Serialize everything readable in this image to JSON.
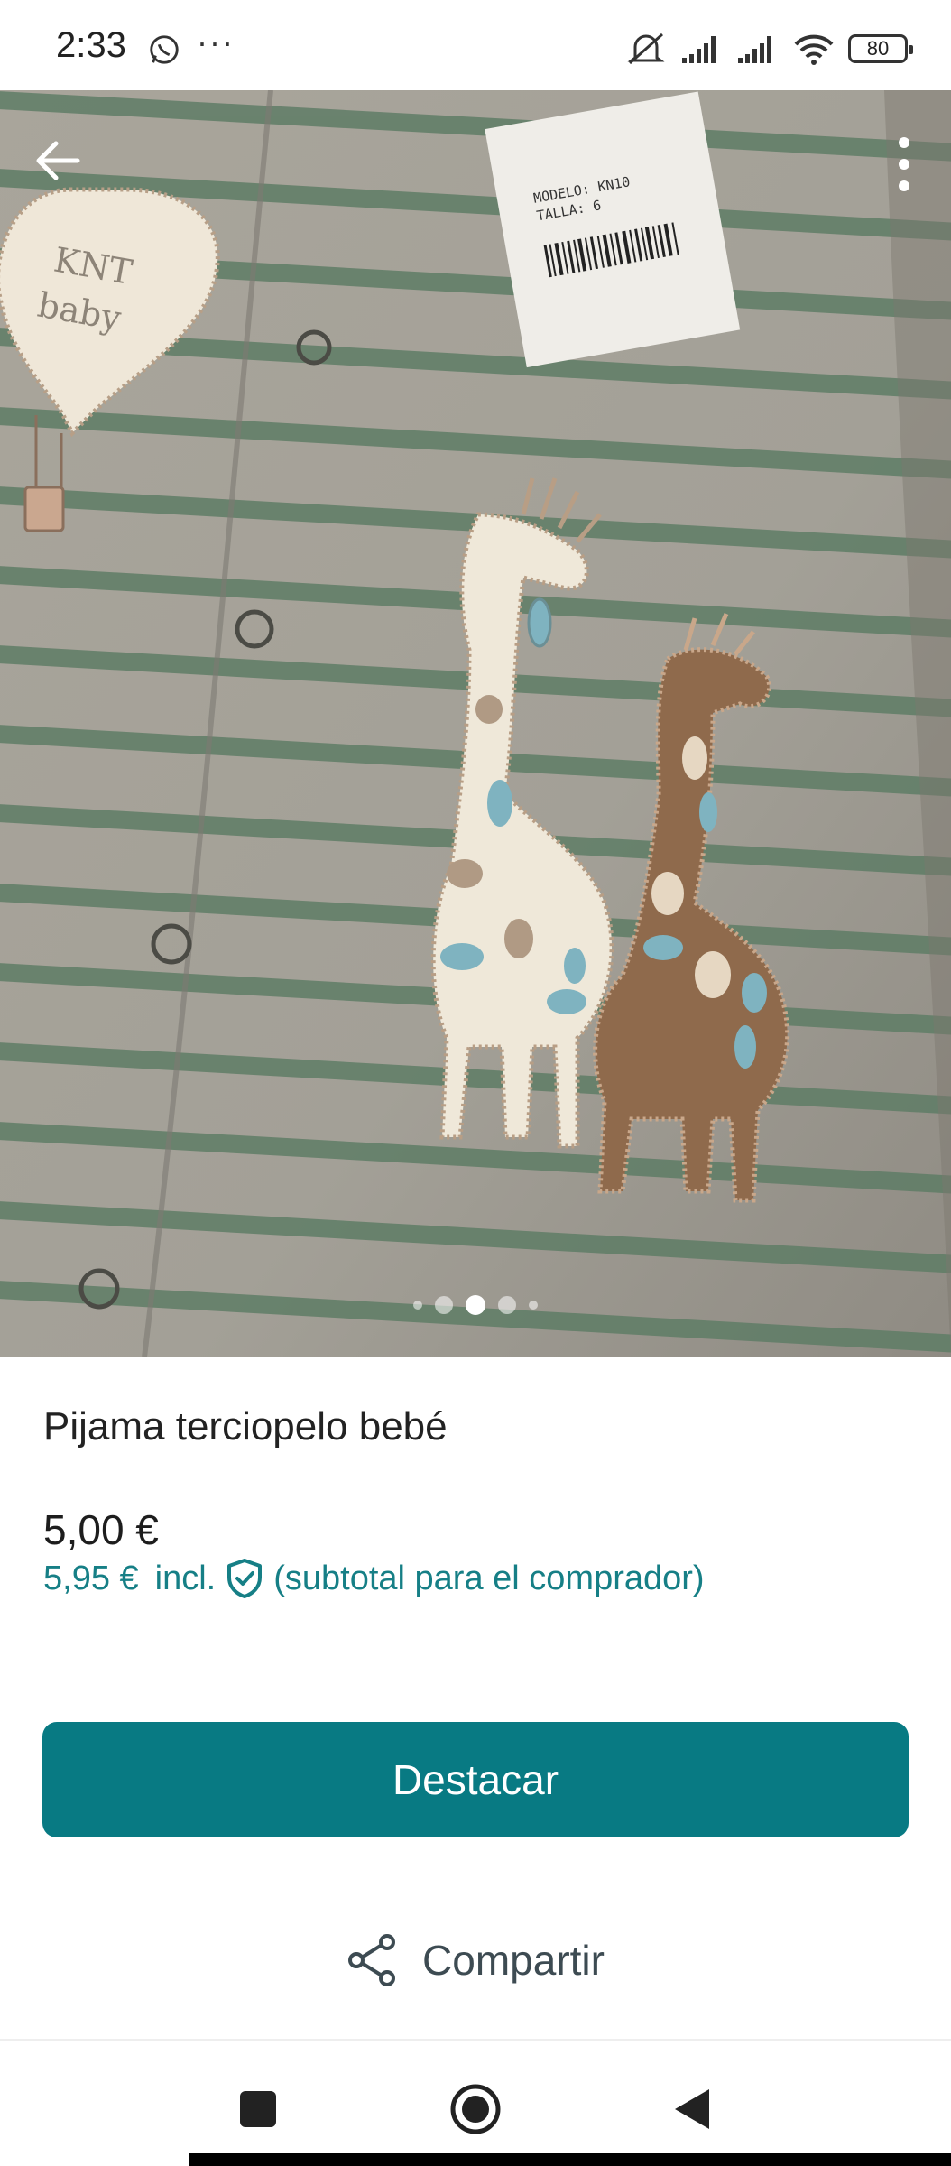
{
  "status_bar": {
    "time": "2:33",
    "more": "···",
    "battery": "80",
    "icons": [
      "whatsapp-icon",
      "mute-icon",
      "signal-icon",
      "signal-icon",
      "wifi-icon",
      "battery-icon"
    ]
  },
  "hero": {
    "back_icon": "arrow-left-icon",
    "menu_icon": "more-vertical-icon",
    "image_count": 5,
    "active_image": 3
  },
  "product": {
    "title": "Pijama terciopelo bebé",
    "price": "5,00 €",
    "buyer_price": "5,95 €",
    "buyer_incl": "incl.",
    "buyer_note": "(subtotal para el comprador)"
  },
  "actions": {
    "feature_label": "Destacar",
    "share_label": "Compartir"
  },
  "colors": {
    "accent": "#087a83",
    "accent_text": "#167f86"
  }
}
